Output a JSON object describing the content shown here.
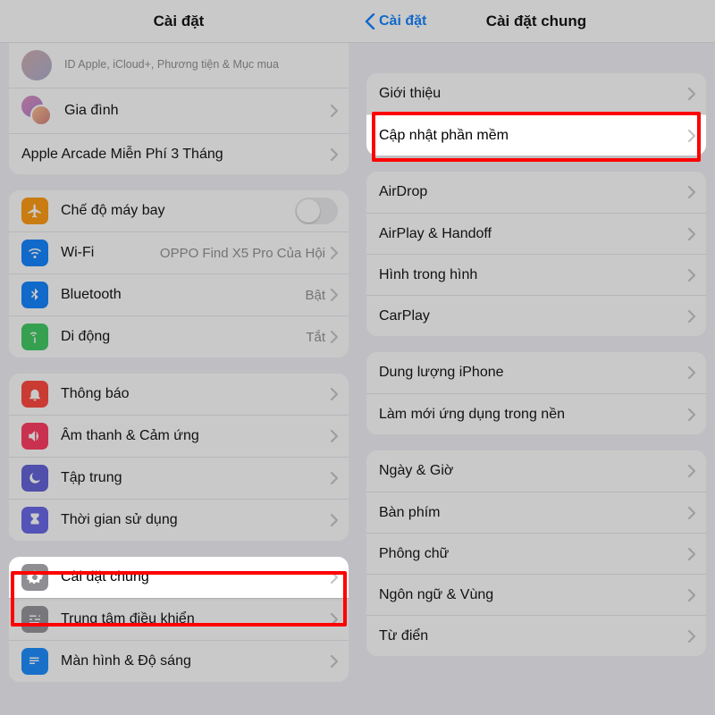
{
  "left": {
    "title": "Cài đặt",
    "apple_id_sub": "ID Apple, iCloud+, Phương tiện & Mục mua",
    "family": "Gia đình",
    "arcade": "Apple Arcade Miễn Phí 3 Tháng",
    "airplane": "Chế độ máy bay",
    "wifi_label": "Wi-Fi",
    "wifi_value": "OPPO Find X5 Pro Của Hội",
    "bluetooth_label": "Bluetooth",
    "bluetooth_value": "Bật",
    "cellular_label": "Di động",
    "cellular_value": "Tắt",
    "notifications": "Thông báo",
    "sound": "Âm thanh & Cảm ứng",
    "focus": "Tập trung",
    "screentime": "Thời gian sử dụng",
    "general": "Cài đặt chung",
    "control_center": "Trung tâm điều khiển",
    "display": "Màn hình & Độ sáng"
  },
  "right": {
    "back_label": "Cài đặt",
    "title": "Cài đặt chung",
    "about": "Giới thiệu",
    "software_update": "Cập nhật phần mềm",
    "airdrop": "AirDrop",
    "airplay": "AirPlay & Handoff",
    "pip": "Hình trong hình",
    "carplay": "CarPlay",
    "storage": "Dung lượng iPhone",
    "bg_refresh": "Làm mới ứng dụng trong nền",
    "datetime": "Ngày & Giờ",
    "keyboard": "Bàn phím",
    "fonts": "Phông chữ",
    "lang_region": "Ngôn ngữ & Vùng",
    "dictionary": "Từ điển"
  }
}
